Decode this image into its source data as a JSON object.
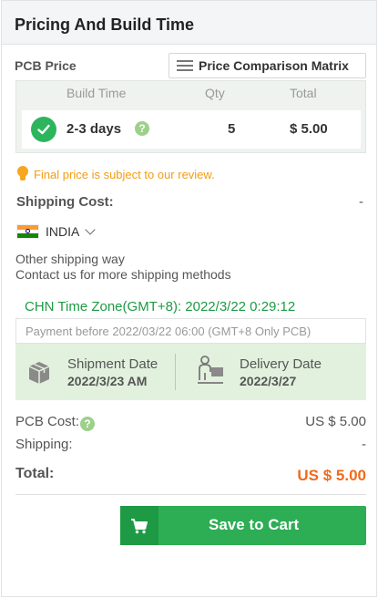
{
  "header": {
    "title": "Pricing And Build Time"
  },
  "pcb_price": {
    "label": "PCB Price",
    "compare_button": "Price Comparison Matrix",
    "columns": [
      "Build Time",
      "Qty",
      "Total"
    ],
    "row": {
      "build_time": "2-3 days",
      "help": "?",
      "qty": "5",
      "total": "$ 5.00"
    }
  },
  "notice": "Final price is subject to our review.",
  "shipping": {
    "label": "Shipping Cost:",
    "value": "-",
    "country": "INDIA",
    "other_way": "Other shipping way",
    "contact": "Contact us for more shipping methods"
  },
  "time": {
    "timezone": "CHN Time Zone(GMT+8): 2022/3/22 0:29:12",
    "payment_before": "Payment before 2022/03/22 06:00 (GMT+8 Only PCB)",
    "shipment_label": "Shipment Date",
    "shipment_value": "2022/3/23 AM",
    "delivery_label": "Delivery Date",
    "delivery_value": "2022/3/27"
  },
  "summary": {
    "pcb_cost_label": "PCB Cost:",
    "pcb_cost_help": "?",
    "pcb_cost_value": "US $ 5.00",
    "shipping_label": "Shipping:",
    "shipping_value": "-",
    "total_label": "Total:",
    "total_value": "US $ 5.00"
  },
  "cart_button": {
    "label": "Save to Cart"
  },
  "colors": {
    "accent_green": "#2dad54",
    "total_orange": "#f06a1b",
    "notice_orange": "#f39c12",
    "timezone_green": "#1d9a44"
  },
  "icons": [
    "list-icon",
    "check-icon",
    "help-icon",
    "bulb-icon",
    "india-flag-icon",
    "chevron-down-icon",
    "package-icon",
    "delivery-person-icon",
    "cart-icon"
  ]
}
